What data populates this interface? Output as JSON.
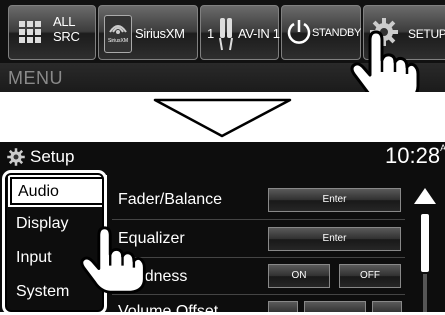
{
  "top_bar": {
    "sources": [
      {
        "label": "ALL\nSRC",
        "icon": "grid-icon"
      },
      {
        "label": "SiriusXM",
        "badge": "SiriusXM",
        "icon": "siriusxm-icon"
      },
      {
        "label": "AV-IN 1",
        "number": "1",
        "icon": "av-in-icon"
      },
      {
        "label": "STANDBY",
        "icon": "power-icon"
      },
      {
        "label": "SETUP",
        "icon": "gear-icon"
      }
    ],
    "menu_label": "MENU"
  },
  "setup_screen": {
    "title": "Setup",
    "clock": "10:28",
    "clock_suffix": "AM",
    "tabs": [
      {
        "label": "Audio",
        "selected": true
      },
      {
        "label": "Display",
        "selected": false
      },
      {
        "label": "Input",
        "selected": false
      },
      {
        "label": "System",
        "selected": false
      }
    ],
    "rows": [
      {
        "label": "Fader/Balance",
        "buttons": [
          "Enter"
        ]
      },
      {
        "label": "Equalizer",
        "buttons": [
          "Enter"
        ]
      },
      {
        "label": "Loudness",
        "buttons": [
          "ON",
          "OFF"
        ]
      },
      {
        "label": "Volume Offset",
        "buttons": [
          "",
          "",
          ""
        ]
      }
    ]
  },
  "colors": {
    "background": "#0d0d0d",
    "text": "#ffffff",
    "button_border": "#888888"
  }
}
